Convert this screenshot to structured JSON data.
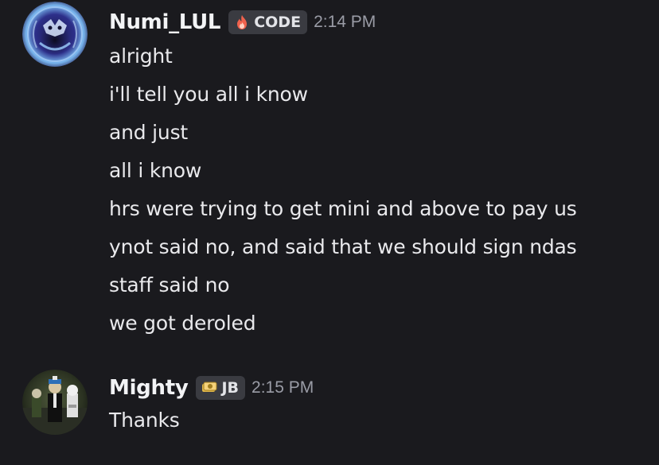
{
  "messages": [
    {
      "author": "Numi_LUL",
      "tag": "CODE",
      "tag_icon": "fire-icon",
      "tag_color": "#f0624d",
      "timestamp": "2:14 PM",
      "lines": [
        "alright",
        "i'll tell you all i know",
        "and just",
        "all i know",
        "hrs were trying to get mini and above to pay us",
        "ynot said no, and said that we should sign ndas",
        "staff said no",
        "we got deroled"
      ]
    },
    {
      "author": "Mighty",
      "tag": "JB",
      "tag_icon": "money-icon",
      "tag_color": "#e2b84a",
      "timestamp": "2:15 PM",
      "lines": [
        "Thanks"
      ]
    }
  ],
  "theme": {
    "background": "#1a1a1e",
    "text": "#e9e9ec",
    "timestamp": "#9a9ca6",
    "tag_background": "#3a3b41"
  }
}
